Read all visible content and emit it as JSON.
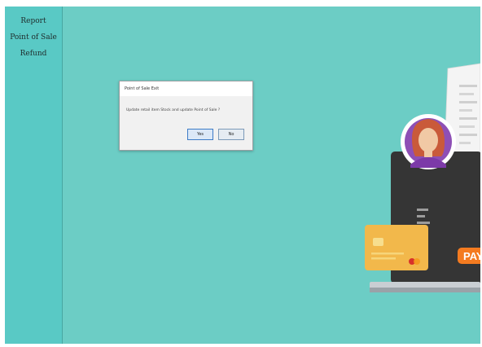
{
  "sidebar": {
    "items": [
      {
        "label": "Report"
      },
      {
        "label": "Point of Sale"
      },
      {
        "label": "Refund"
      }
    ]
  },
  "dialog": {
    "title": "Point of Sale Exit",
    "message": "Update retail item Stock and update Point of Sale ?",
    "buttons": [
      {
        "label": "Yes"
      },
      {
        "label": "No"
      }
    ]
  },
  "illustration": {
    "pay_label": "PAY",
    "icons": [
      "receipt-icon",
      "user-avatar-icon",
      "laptop-icon",
      "credit-card-icon"
    ]
  },
  "colors": {
    "background": "#6ccdc5",
    "sidebar": "#59c9c5",
    "pay_button": "#f47b20",
    "card": "#f2b84b"
  }
}
